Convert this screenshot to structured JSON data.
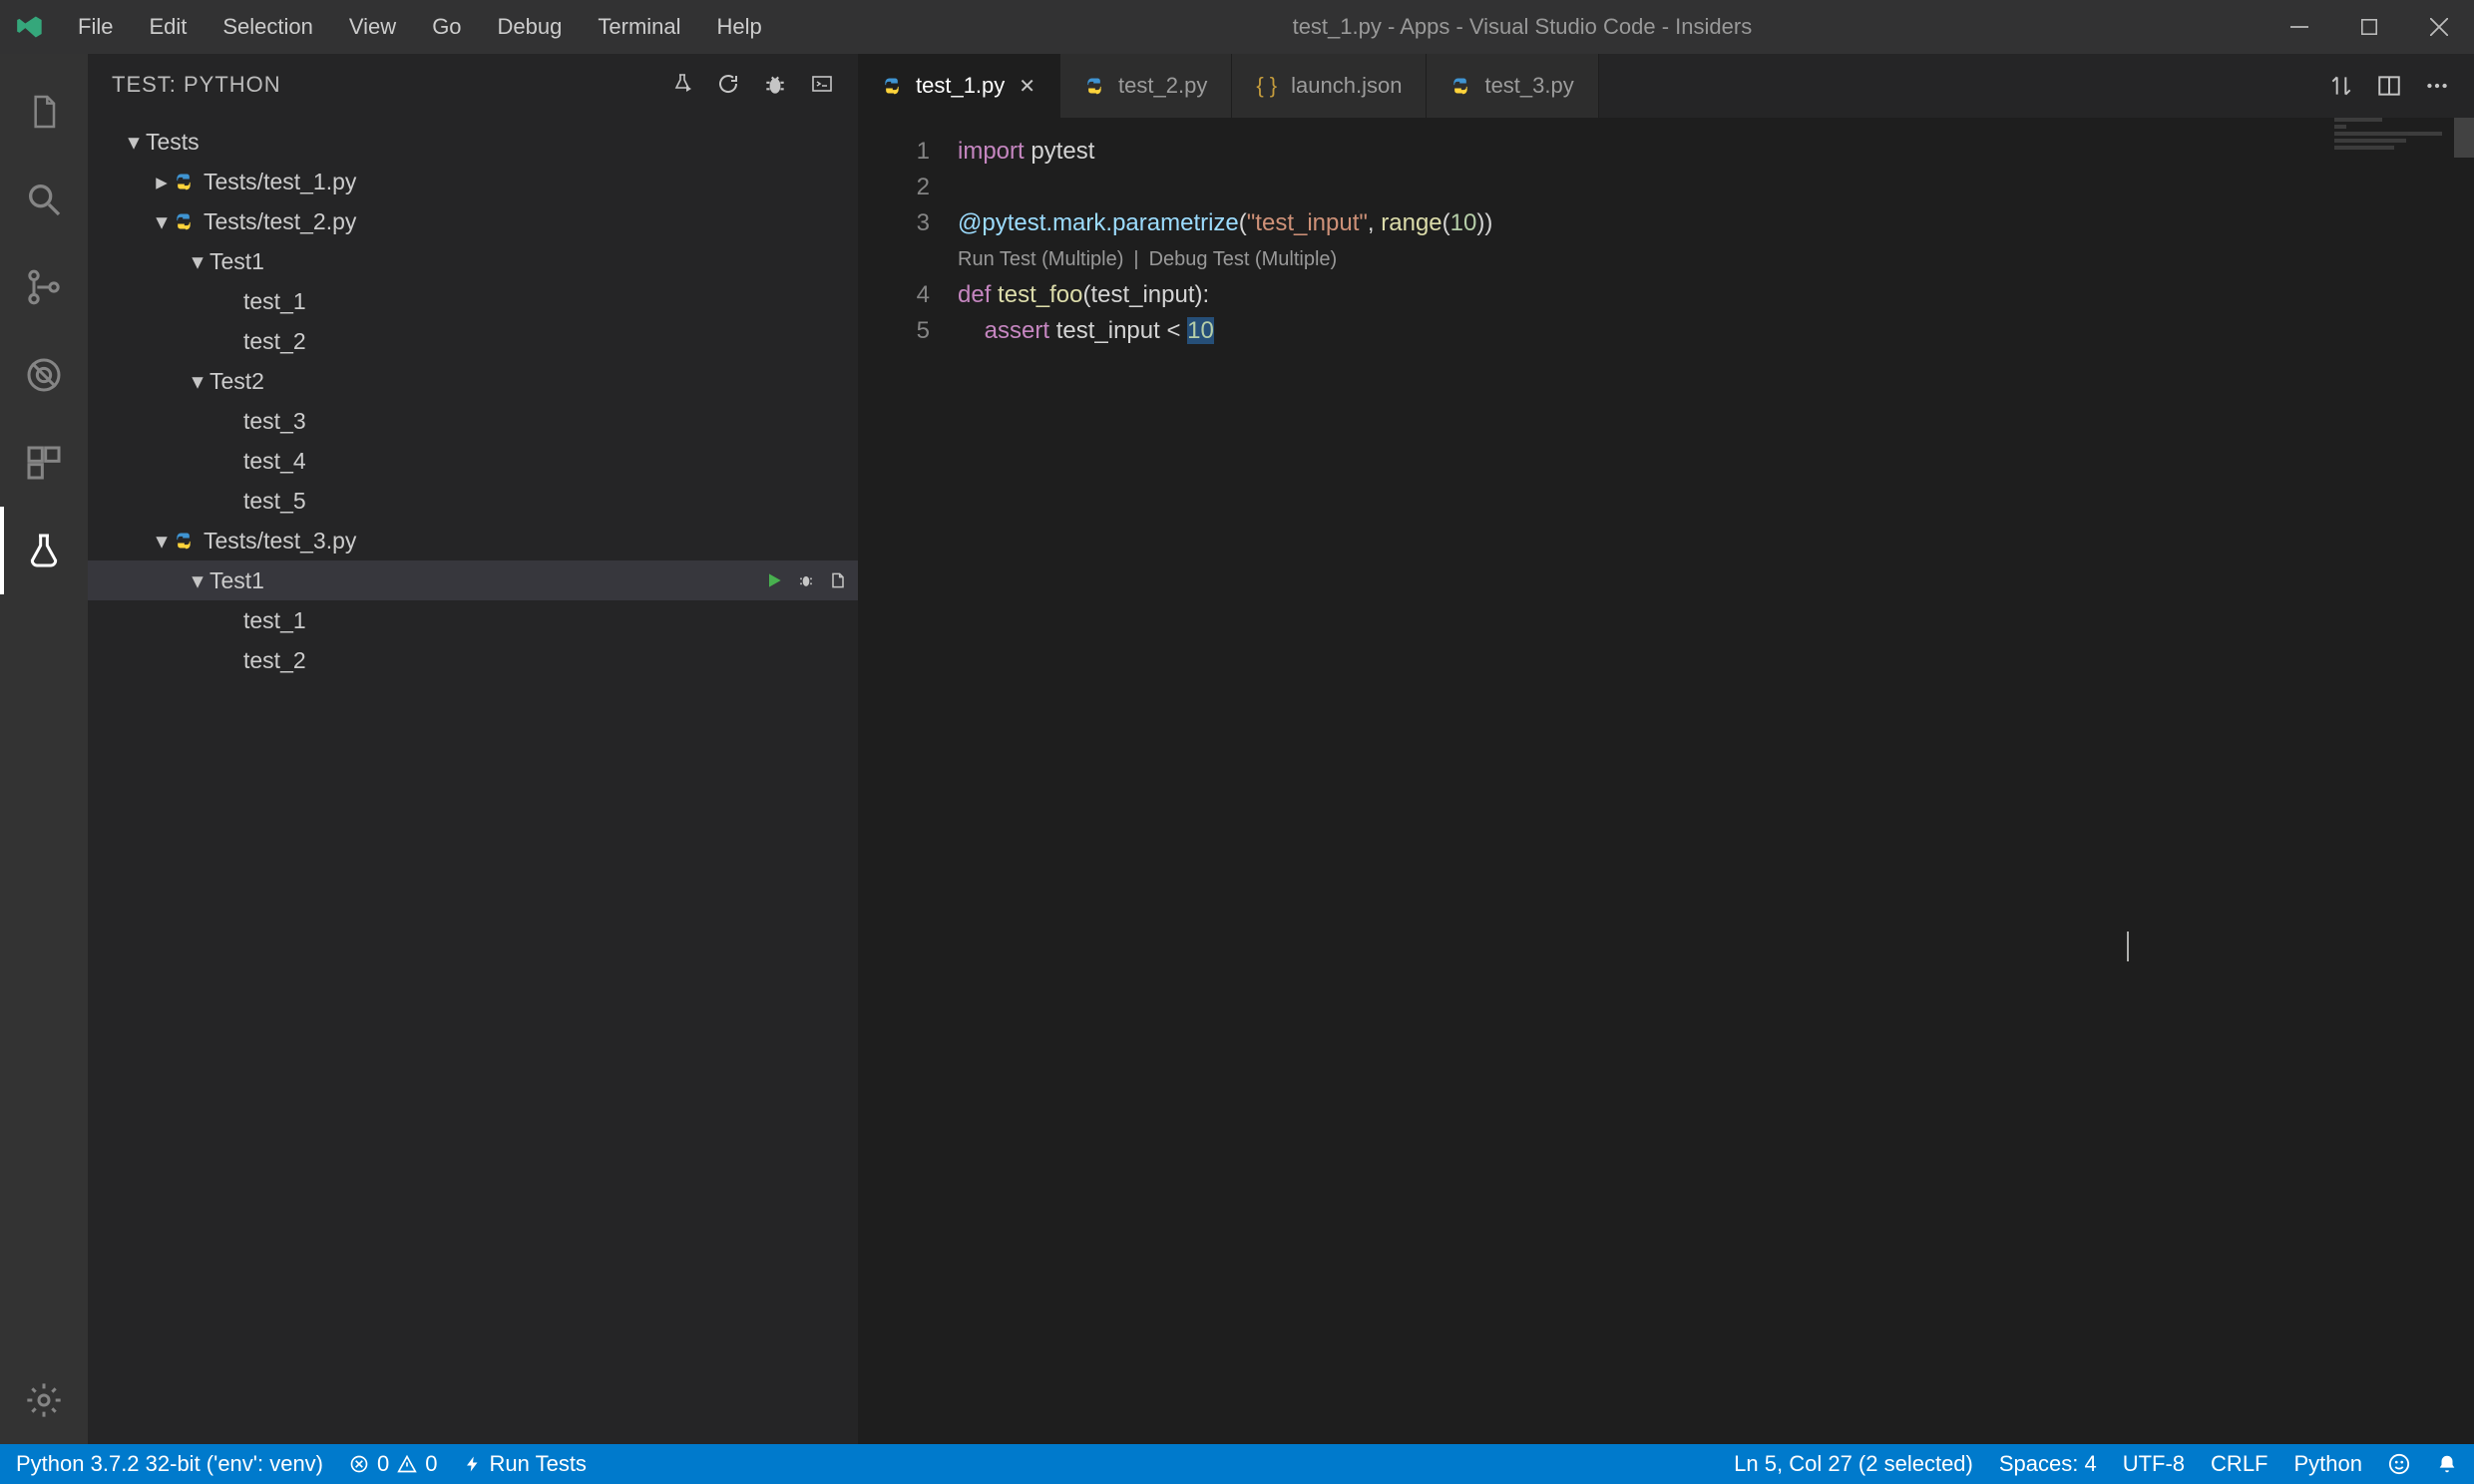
{
  "window_title": "test_1.py - Apps - Visual Studio Code - Insiders",
  "menus": {
    "file": "File",
    "edit": "Edit",
    "selection": "Selection",
    "view": "View",
    "go": "Go",
    "debug": "Debug",
    "terminal": "Terminal",
    "help": "Help"
  },
  "sidebar": {
    "title": "TEST: PYTHON",
    "root": "Tests",
    "files": {
      "f1": "Tests/test_1.py",
      "f2": "Tests/test_2.py",
      "f3": "Tests/test_3.py"
    },
    "groups": {
      "t1": "Test1",
      "t2": "Test2"
    },
    "cases": {
      "c1": "test_1",
      "c2": "test_2",
      "c3": "test_3",
      "c4": "test_4",
      "c5": "test_5"
    }
  },
  "tabs": {
    "t1": "test_1.py",
    "t2": "test_2.py",
    "t3": "launch.json",
    "t4": "test_3.py"
  },
  "code": {
    "l1a": "import",
    "l1b": " pytest",
    "l3a": "@pytest.mark.parametrize",
    "l3b": "(",
    "l3c": "\"test_input\"",
    "l3d": ", ",
    "l3e": "range",
    "l3f": "(",
    "l3g": "10",
    "l3h": "))",
    "lens_run": "Run Test (Multiple)",
    "lens_sep": " | ",
    "lens_debug": "Debug Test (Multiple)",
    "l4a": "def",
    "l4b": " ",
    "l4c": "test_foo",
    "l4d": "(test_input):",
    "l5a": "    ",
    "l5b": "assert",
    "l5c": " test_input < ",
    "l5d": "10"
  },
  "lines": {
    "n1": "1",
    "n2": "2",
    "n3": "3",
    "n4": "4",
    "n5": "5"
  },
  "status": {
    "interpreter": "Python 3.7.2 32-bit ('env': venv)",
    "errors": "0",
    "warnings": "0",
    "run_tests": "Run Tests",
    "cursor": "Ln 5, Col 27 (2 selected)",
    "spaces": "Spaces: 4",
    "encoding": "UTF-8",
    "eol": "CRLF",
    "lang": "Python"
  }
}
